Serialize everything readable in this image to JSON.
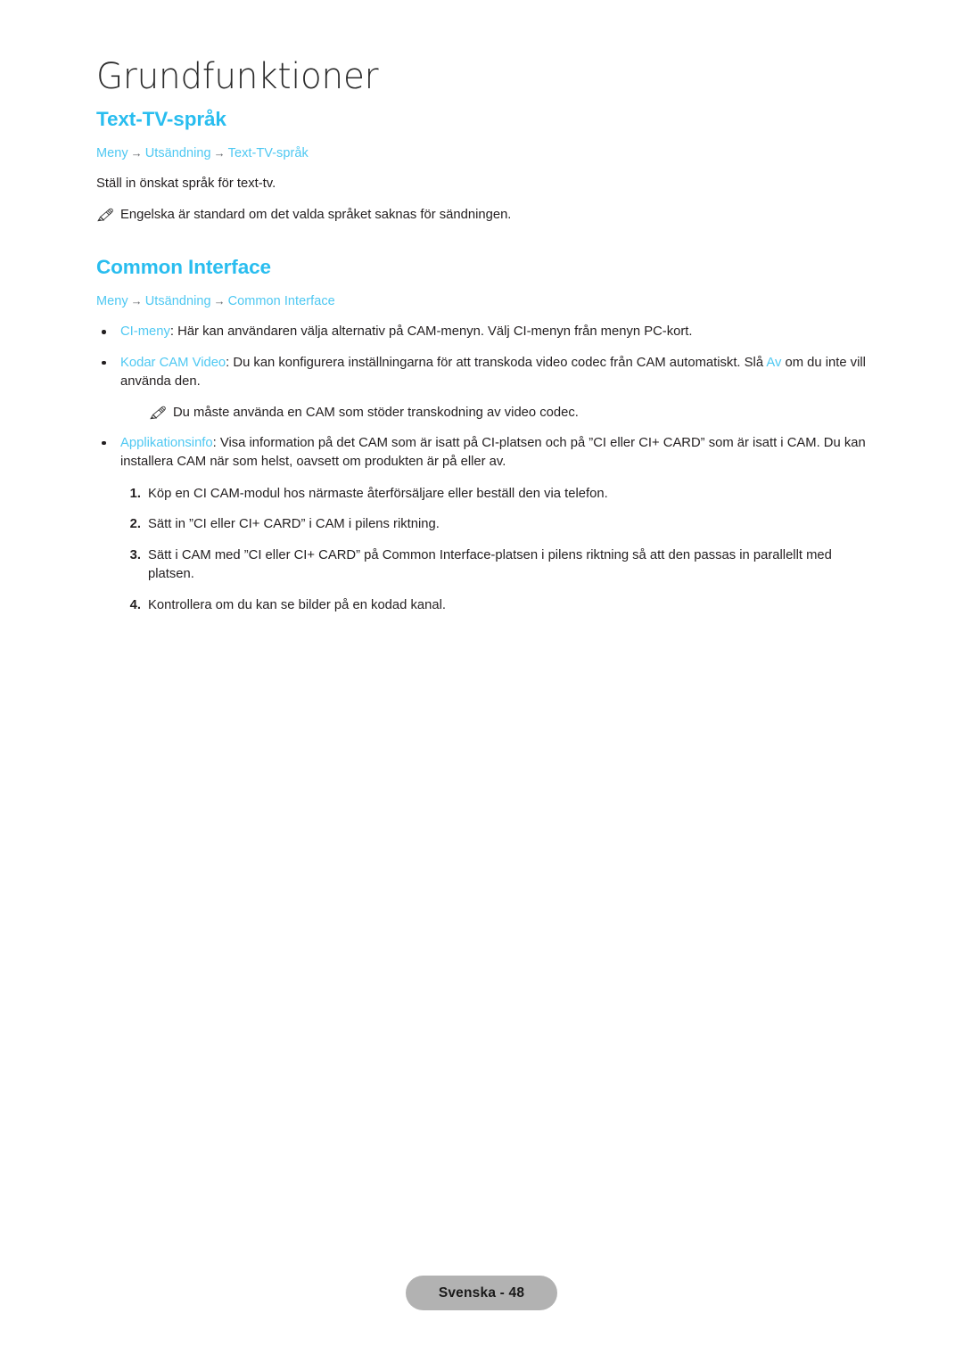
{
  "document": {
    "chapter_title": "Grundfunktioner",
    "language_footer": "Svenska - 48"
  },
  "colors": {
    "heading_cyan": "#29bdef",
    "link_cyan": "#4ec8f2",
    "body_text": "#231f20",
    "footer_badge_bg": "#b2b2b2",
    "page_background": "#ffffff"
  },
  "sections": [
    {
      "heading": "Text-TV-språk",
      "breadcrumb": {
        "items": [
          "Meny",
          "Utsändning",
          "Text-TV-språk"
        ],
        "separator": "→"
      },
      "paragraph": "Ställ in önskat språk för text-tv.",
      "note": "Engelska är standard om det valda språket saknas för sändningen.",
      "note_icon": "pencil-note-icon"
    },
    {
      "heading": "Common Interface",
      "breadcrumb": {
        "items": [
          "Meny",
          "Utsändning",
          "Common Interface"
        ],
        "separator": "→"
      },
      "bullets": [
        {
          "keyword": "CI-meny",
          "text": ": Här kan användaren välja alternativ på CAM-menyn. Välj CI-menyn från menyn PC-kort."
        },
        {
          "keyword": "Kodar CAM Video",
          "text": ": Du kan konfigurera inställningarna för att transkoda video codec från CAM automatiskt. Slå ",
          "trailing_keyword": "Av",
          "text_after": " om du inte vill använda den.",
          "note": "Du måste använda en CAM som stöder transkodning av video codec.",
          "note_icon": "pencil-note-icon"
        },
        {
          "keyword": "Applikationsinfo",
          "text": ": Visa information på det CAM som är isatt på CI-platsen och på ”CI eller CI+ CARD” som är isatt i CAM. Du kan installera CAM när som helst, oavsett om produkten är på eller av."
        }
      ],
      "steps": [
        {
          "number": "1.",
          "text": "Köp en CI CAM-modul hos närmaste återförsäljare eller beställ den via telefon."
        },
        {
          "number": "2.",
          "text": "Sätt in ”CI eller CI+ CARD” i CAM i pilens riktning."
        },
        {
          "number": "3.",
          "text": "Sätt i CAM med ”CI eller CI+ CARD” på Common Interface-platsen i pilens riktning så att den passas in parallellt med platsen."
        },
        {
          "number": "4.",
          "text": "Kontrollera om du kan se bilder på en kodad kanal."
        }
      ]
    }
  ]
}
